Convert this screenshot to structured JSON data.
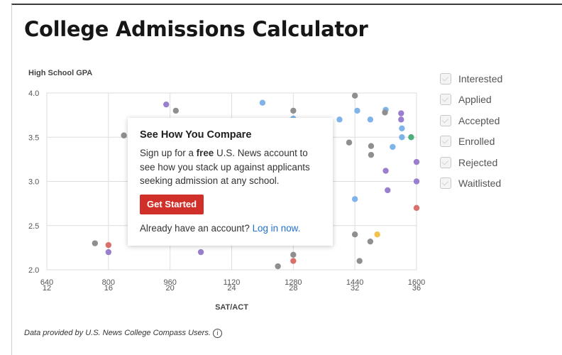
{
  "page": {
    "title": "College Admissions Calculator",
    "footnote": "Data provided by U.S. News College Compass Users.",
    "info_icon": "info-circle-icon"
  },
  "legend": [
    {
      "label": "Interested"
    },
    {
      "label": "Applied"
    },
    {
      "label": "Accepted"
    },
    {
      "label": "Enrolled"
    },
    {
      "label": "Rejected"
    },
    {
      "label": "Waitlisted"
    }
  ],
  "popup": {
    "title": "See How You Compare",
    "body_pre": "Sign up for a ",
    "body_bold": "free",
    "body_post": " U.S. News account to see how you stack up against applicants seeking admission at any school.",
    "button_label": "Get Started",
    "login_prompt": "Already have an account?",
    "login_link": "Log in now."
  },
  "chart_data": {
    "type": "scatter",
    "ylabel": "High School GPA",
    "xlabel": "SAT/ACT",
    "xlim": [
      640,
      1600
    ],
    "ylim": [
      2.0,
      4.0
    ],
    "x_ticks": [
      640,
      800,
      960,
      1120,
      1280,
      1440,
      1600
    ],
    "x_ticks_secondary": [
      12,
      16,
      20,
      24,
      28,
      32,
      36
    ],
    "y_ticks": [
      2.0,
      2.5,
      3.0,
      3.5,
      4.0
    ],
    "grid": true,
    "colors": {
      "gray": "#8f8f8f",
      "purple": "#9a7fcf",
      "blue": "#7fb3ea",
      "red": "#d9706a",
      "green": "#4caf7a",
      "yellow": "#f2c14e"
    },
    "points": [
      {
        "x": 1440,
        "y": 3.97,
        "c": "gray"
      },
      {
        "x": 1200,
        "y": 3.89,
        "c": "blue"
      },
      {
        "x": 950,
        "y": 3.87,
        "c": "purple"
      },
      {
        "x": 1280,
        "y": 3.8,
        "c": "gray"
      },
      {
        "x": 1446,
        "y": 3.8,
        "c": "blue"
      },
      {
        "x": 1520,
        "y": 3.81,
        "c": "blue"
      },
      {
        "x": 1518,
        "y": 3.78,
        "c": "gray"
      },
      {
        "x": 1560,
        "y": 3.77,
        "c": "purple"
      },
      {
        "x": 1560,
        "y": 3.7,
        "c": "purple"
      },
      {
        "x": 1480,
        "y": 3.7,
        "c": "blue"
      },
      {
        "x": 1400,
        "y": 3.7,
        "c": "blue"
      },
      {
        "x": 1562,
        "y": 3.6,
        "c": "blue"
      },
      {
        "x": 1562,
        "y": 3.5,
        "c": "blue"
      },
      {
        "x": 1586,
        "y": 3.5,
        "c": "green"
      },
      {
        "x": 1425,
        "y": 3.44,
        "c": "gray"
      },
      {
        "x": 1482,
        "y": 3.4,
        "c": "gray"
      },
      {
        "x": 1538,
        "y": 3.39,
        "c": "blue"
      },
      {
        "x": 1482,
        "y": 3.3,
        "c": "gray"
      },
      {
        "x": 1600,
        "y": 3.22,
        "c": "purple"
      },
      {
        "x": 1520,
        "y": 3.12,
        "c": "purple"
      },
      {
        "x": 1600,
        "y": 3.0,
        "c": "purple"
      },
      {
        "x": 1525,
        "y": 2.9,
        "c": "purple"
      },
      {
        "x": 1440,
        "y": 2.8,
        "c": "blue"
      },
      {
        "x": 1600,
        "y": 2.7,
        "c": "red"
      },
      {
        "x": 1440,
        "y": 2.4,
        "c": "gray"
      },
      {
        "x": 1498,
        "y": 2.4,
        "c": "yellow"
      },
      {
        "x": 1480,
        "y": 2.32,
        "c": "gray"
      },
      {
        "x": 1452,
        "y": 2.1,
        "c": "gray"
      },
      {
        "x": 1280,
        "y": 2.17,
        "c": "gray"
      },
      {
        "x": 1280,
        "y": 2.1,
        "c": "red"
      },
      {
        "x": 1240,
        "y": 2.04,
        "c": "gray"
      },
      {
        "x": 1040,
        "y": 2.2,
        "c": "purple"
      },
      {
        "x": 800,
        "y": 2.2,
        "c": "purple"
      },
      {
        "x": 800,
        "y": 2.28,
        "c": "red"
      },
      {
        "x": 765,
        "y": 2.3,
        "c": "gray"
      },
      {
        "x": 1265,
        "y": 2.42,
        "c": "gray"
      },
      {
        "x": 1280,
        "y": 2.48,
        "c": "gray"
      },
      {
        "x": 1270,
        "y": 2.34,
        "c": "purple"
      },
      {
        "x": 1275,
        "y": 3.69,
        "c": "gray"
      },
      {
        "x": 1280,
        "y": 3.71,
        "c": "blue"
      },
      {
        "x": 1285,
        "y": 3.6,
        "c": "gray"
      },
      {
        "x": 1290,
        "y": 3.56,
        "c": "purple"
      },
      {
        "x": 1265,
        "y": 3.02,
        "c": "gray"
      },
      {
        "x": 1282,
        "y": 2.97,
        "c": "purple"
      },
      {
        "x": 1260,
        "y": 2.74,
        "c": "gray"
      },
      {
        "x": 1278,
        "y": 2.84,
        "c": "blue"
      },
      {
        "x": 1070,
        "y": 3.0,
        "c": "gray"
      },
      {
        "x": 1110,
        "y": 2.6,
        "c": "gray"
      },
      {
        "x": 1160,
        "y": 3.2,
        "c": "purple"
      },
      {
        "x": 1180,
        "y": 2.55,
        "c": "gray"
      },
      {
        "x": 1000,
        "y": 3.35,
        "c": "gray"
      },
      {
        "x": 1040,
        "y": 2.9,
        "c": "purple"
      },
      {
        "x": 1010,
        "y": 2.55,
        "c": "gray"
      },
      {
        "x": 975,
        "y": 3.8,
        "c": "gray"
      },
      {
        "x": 840,
        "y": 3.52,
        "c": "gray"
      }
    ]
  }
}
